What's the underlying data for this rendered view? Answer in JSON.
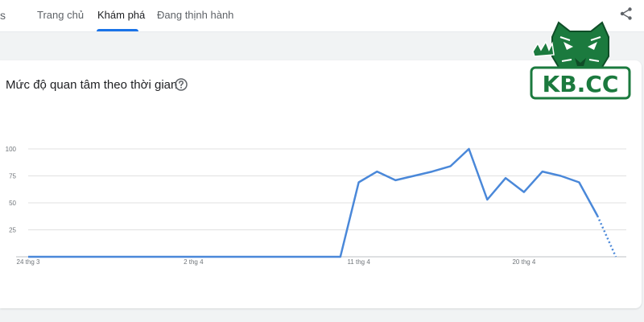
{
  "header": {
    "brand_fragment": "s",
    "tabs": [
      {
        "label": "Trang chủ",
        "active": false
      },
      {
        "label": "Khám phá",
        "active": true
      },
      {
        "label": "Đang thịnh hành",
        "active": false
      }
    ],
    "share_icon": "share-icon"
  },
  "card": {
    "title": "Mức độ quan tâm theo thời gian",
    "help_icon": "help-circle-icon"
  },
  "logo": {
    "text": "KB.CC",
    "icon": "tiger-head-logo"
  },
  "colors": {
    "line": "#4a88d9",
    "accent": "#1a73e8",
    "logo_green": "#1b7a3e"
  },
  "chart_data": {
    "type": "line",
    "title": "Mức độ quan tâm theo thời gian",
    "xlabel": "",
    "ylabel": "",
    "ylim": [
      0,
      100
    ],
    "yticks": [
      25,
      50,
      75,
      100
    ],
    "x_tick_labels": [
      {
        "day": 0,
        "label": "24 thg 3"
      },
      {
        "day": 9,
        "label": "2 thg 4"
      },
      {
        "day": 18,
        "label": "11 thg 4"
      },
      {
        "day": 27,
        "label": "20 thg 4"
      }
    ],
    "grid": true,
    "series": [
      {
        "values": [
          0,
          0,
          0,
          0,
          0,
          0,
          0,
          0,
          0,
          0,
          0,
          0,
          0,
          0,
          0,
          0,
          0,
          0,
          69,
          79,
          71,
          75,
          79,
          84,
          100,
          53,
          73,
          60,
          79,
          75,
          69,
          38
        ],
        "partial_tail": [
          38,
          0
        ]
      }
    ]
  }
}
